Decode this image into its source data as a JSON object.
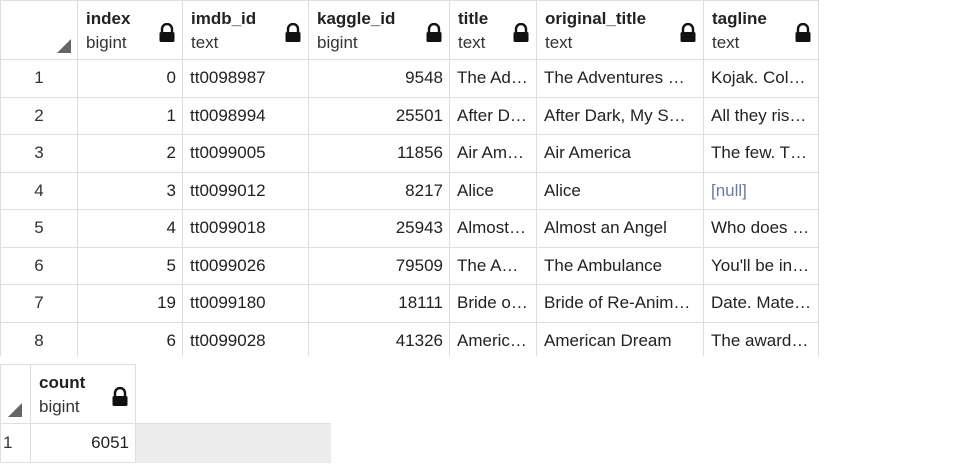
{
  "grid1": {
    "columns": [
      {
        "name": "index",
        "type": "bigint"
      },
      {
        "name": "imdb_id",
        "type": "text"
      },
      {
        "name": "kaggle_id",
        "type": "bigint"
      },
      {
        "name": "title",
        "type": "text"
      },
      {
        "name": "original_title",
        "type": "text"
      },
      {
        "name": "tagline",
        "type": "text"
      }
    ],
    "rows": [
      {
        "n": "1",
        "index": "0",
        "imdb_id": "tt0098987",
        "kaggle_id": "9548",
        "title": "The Ad…",
        "original_title": "The Adventures …",
        "tagline": "Kojak. Col…"
      },
      {
        "n": "2",
        "index": "1",
        "imdb_id": "tt0098994",
        "kaggle_id": "25501",
        "title": "After D…",
        "original_title": "After Dark, My S…",
        "tagline": "All they ris…"
      },
      {
        "n": "3",
        "index": "2",
        "imdb_id": "tt0099005",
        "kaggle_id": "11856",
        "title": "Air Am…",
        "original_title": "Air America",
        "tagline": "The few. T…"
      },
      {
        "n": "4",
        "index": "3",
        "imdb_id": "tt0099012",
        "kaggle_id": "8217",
        "title": "Alice",
        "original_title": "Alice",
        "tagline": "[null]"
      },
      {
        "n": "5",
        "index": "4",
        "imdb_id": "tt0099018",
        "kaggle_id": "25943",
        "title": "Almost…",
        "original_title": "Almost an Angel",
        "tagline": "Who does …"
      },
      {
        "n": "6",
        "index": "5",
        "imdb_id": "tt0099026",
        "kaggle_id": "79509",
        "title": "The A…",
        "original_title": "The Ambulance",
        "tagline": "You'll be in…"
      },
      {
        "n": "7",
        "index": "19",
        "imdb_id": "tt0099180",
        "kaggle_id": "18111",
        "title": "Bride o…",
        "original_title": "Bride of Re-Anim…",
        "tagline": "Date. Mate…"
      },
      {
        "n": "8",
        "index": "6",
        "imdb_id": "tt0099028",
        "kaggle_id": "41326",
        "title": "Americ…",
        "original_title": "American Dream",
        "tagline": "The award…"
      }
    ]
  },
  "grid2": {
    "column": {
      "name": "count",
      "type": "bigint"
    },
    "row": {
      "n": "1",
      "count": "6051"
    }
  }
}
